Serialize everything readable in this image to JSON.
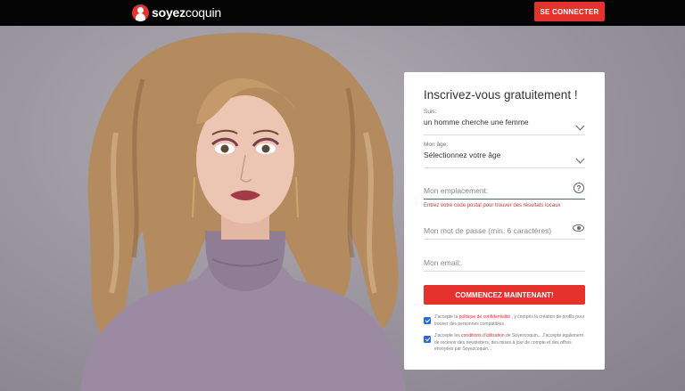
{
  "header": {
    "brand_bold": "soyez",
    "brand_regular": "coquin",
    "login_label": "SE CONNECTER"
  },
  "form": {
    "title": "Inscrivez-vous gratuitement !",
    "suis_label": "Suis:",
    "suis_value": "un homme cherche une femme",
    "age_label": "Mon âge:",
    "age_value": "Sélectionnez votre âge",
    "location_placeholder": "Mon emplacement:",
    "location_error": "Entrez votre code postal pour trouver des résultats locaux",
    "password_placeholder": "Mon mot de passe (min. 6 caractères)",
    "email_placeholder": "Mon email:",
    "submit_label": "COMMENCEZ MAINTENANT!"
  },
  "consents": [
    {
      "checked": true,
      "before": "J'accepte la ",
      "link": "politique de confidentialité",
      "after": " , y compris la création de profils pour trouver des personnes compatibles."
    },
    {
      "checked": true,
      "before": "J'accepte les ",
      "link": "conditions d'utilisation",
      "after": " de Soyezcoquin... J'accepte également de recevoir des newsletters, des mises à jour de compte et des offres envoyées par Soyezcoquin..."
    }
  ],
  "colors": {
    "accent": "#e5322d",
    "topbar": "#050505",
    "checkbox": "#2b6ad8"
  },
  "icons": {
    "logo": "woman-silhouette-icon",
    "dropdown": "chevron-down-icon",
    "help": "question-circle-icon",
    "password_toggle": "eye-icon"
  }
}
